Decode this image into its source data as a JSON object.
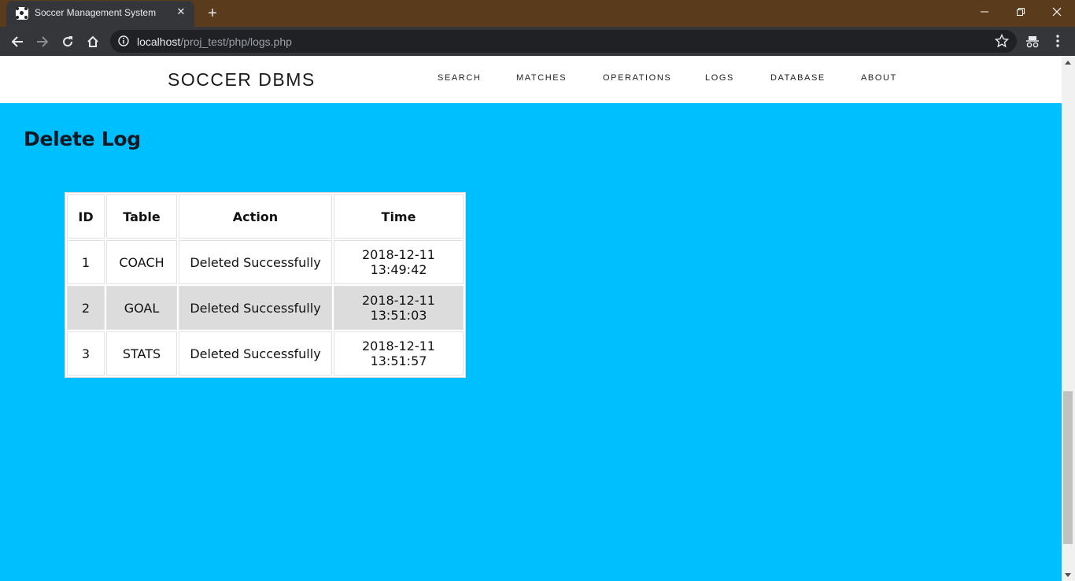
{
  "browser": {
    "tab_title": "Soccer Management System",
    "url_host": "localhost",
    "url_path": "/proj_test/php/logs.php"
  },
  "site": {
    "brand": "SOCCER DBMS",
    "nav": [
      "SEARCH",
      "MATCHES",
      "OPERATIONS",
      "LOGS",
      "DATABASE",
      "ABOUT"
    ]
  },
  "page": {
    "title": "Delete Log"
  },
  "table": {
    "headers": [
      "ID",
      "Table",
      "Action",
      "Time"
    ],
    "rows": [
      [
        "1",
        "COACH",
        "Deleted Successfully",
        "2018-12-11 13:49:42"
      ],
      [
        "2",
        "GOAL",
        "Deleted Successfully",
        "2018-12-11 13:51:03"
      ],
      [
        "3",
        "STATS",
        "Deleted Successfully",
        "2018-12-11 13:51:57"
      ]
    ]
  },
  "colors": {
    "page_background": "#00bfff",
    "header_background": "#ffffff",
    "title_bar": "#5a3b1b",
    "alt_row": "#dcdcdc"
  }
}
